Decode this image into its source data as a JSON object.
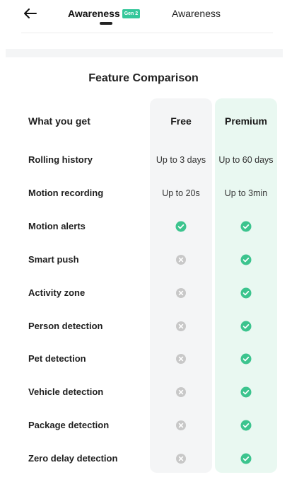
{
  "header": {
    "active_tab": "Awareness",
    "active_badge": "Gen 2",
    "inactive_tab": "Awareness"
  },
  "comparison": {
    "title": "Feature Comparison",
    "head": {
      "feature": "What you get",
      "free": "Free",
      "premium": "Premium"
    },
    "rows": [
      {
        "feature": "Rolling history",
        "free": "Up to 3 days",
        "premium": "Up to 60 days"
      },
      {
        "feature": "Motion recording",
        "free": "Up to 20s",
        "premium": "Up to 3min"
      },
      {
        "feature": "Motion alerts",
        "free": "check",
        "premium": "check"
      },
      {
        "feature": "Smart push",
        "free": "cross",
        "premium": "check"
      },
      {
        "feature": "Activity zone",
        "free": "cross",
        "premium": "check"
      },
      {
        "feature": "Person detection",
        "free": "cross",
        "premium": "check"
      },
      {
        "feature": "Pet detection",
        "free": "cross",
        "premium": "check"
      },
      {
        "feature": "Vehicle detection",
        "free": "cross",
        "premium": "check"
      },
      {
        "feature": "Package detection",
        "free": "cross",
        "premium": "check"
      },
      {
        "feature": "Zero delay detection",
        "free": "cross",
        "premium": "check"
      }
    ]
  },
  "colors": {
    "accent": "#34c79a",
    "check": "#3cc48e",
    "cross": "#c8c8c8",
    "free_column_bg": "#f4f5f6",
    "premium_column_bg": "#e9f8f1"
  },
  "icons": {
    "back": "arrow-left-icon",
    "included": "check-circle-icon",
    "excluded": "cross-circle-icon"
  }
}
